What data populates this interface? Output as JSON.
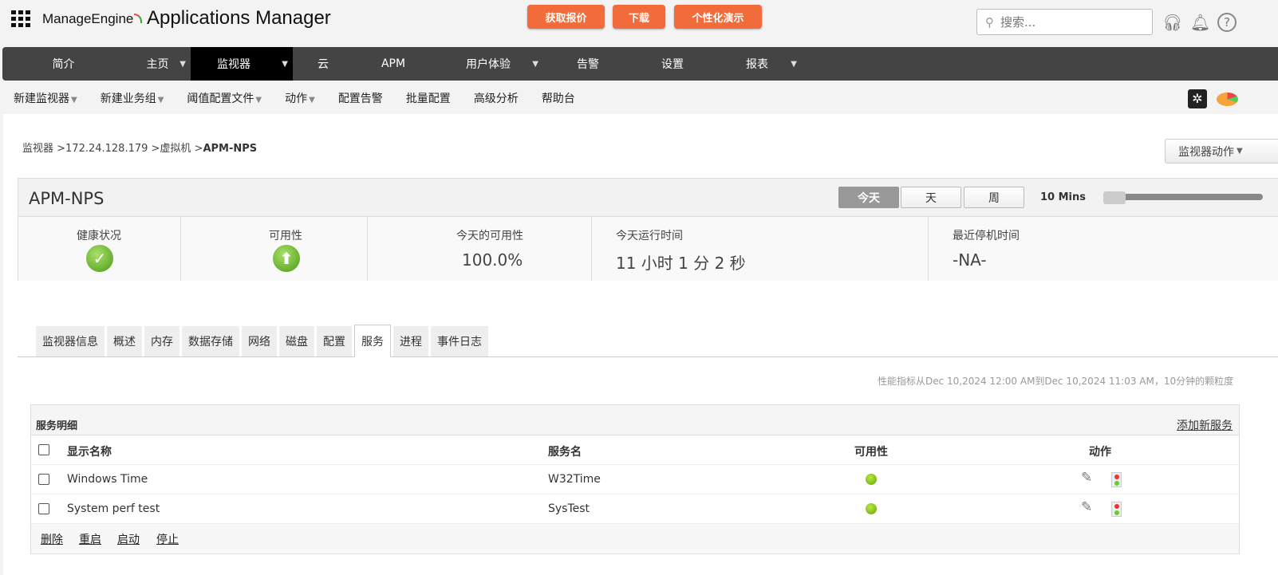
{
  "header": {
    "brand": "ManageEngine",
    "product": "Applications Manager",
    "cta": [
      "获取报价",
      "下载",
      "个性化演示"
    ],
    "search_placeholder": "搜索..."
  },
  "nav": [
    {
      "label": "简介"
    },
    {
      "label": "主页",
      "dropdown": true
    },
    {
      "label": "监视器",
      "dropdown": true,
      "active": true
    },
    {
      "label": "云"
    },
    {
      "label": "APM"
    },
    {
      "label": "用户体验",
      "dropdown": true
    },
    {
      "label": "告警"
    },
    {
      "label": "设置"
    },
    {
      "label": "报表",
      "dropdown": true
    }
  ],
  "subnav": [
    "新建监视器",
    "新建业务组",
    "阈值配置文件",
    "动作",
    "配置告警",
    "批量配置",
    "高级分析",
    "帮助台"
  ],
  "breadcrumb": {
    "path": "监视器 >172.24.128.179 >虚拟机 >",
    "current": "APM-NPS"
  },
  "monitor_actions": "监视器动作",
  "summary": {
    "title": "APM-NPS",
    "periods": [
      "今天",
      "天",
      "周"
    ],
    "interval": "10 Mins",
    "slider_fraction": 0.0,
    "health_label": "健康状况",
    "availability_label": "可用性",
    "today_avail_label": "今天的可用性",
    "today_avail": "100.0%",
    "uptime_label": "今天运行时间",
    "uptime": "11 小时 1 分 2 秒",
    "downtime_label": "最近停机时间",
    "downtime": "-NA-"
  },
  "tabs": [
    "监视器信息",
    "概述",
    "内存",
    "数据存储",
    "网络",
    "磁盘",
    "配置",
    "服务",
    "进程",
    "事件日志"
  ],
  "note": "性能指标从Dec 10,2024 12:00 AM到Dec 10,2024 11:03 AM，10分钟的颗粒度",
  "table": {
    "title": "服务明细",
    "add_link": "添加新服务",
    "columns": [
      "显示名称",
      "服务名",
      "可用性",
      "动作"
    ],
    "rows": [
      {
        "display": "Windows Time",
        "service": "W32Time",
        "status": "up"
      },
      {
        "display": "System perf test",
        "service": "SysTest",
        "status": "up"
      }
    ],
    "actions": [
      "删除",
      "重启",
      "启动",
      "停止"
    ]
  },
  "colors": {
    "accent": "#f26b3a",
    "nav": "#444444",
    "up": "#7ab51d"
  }
}
